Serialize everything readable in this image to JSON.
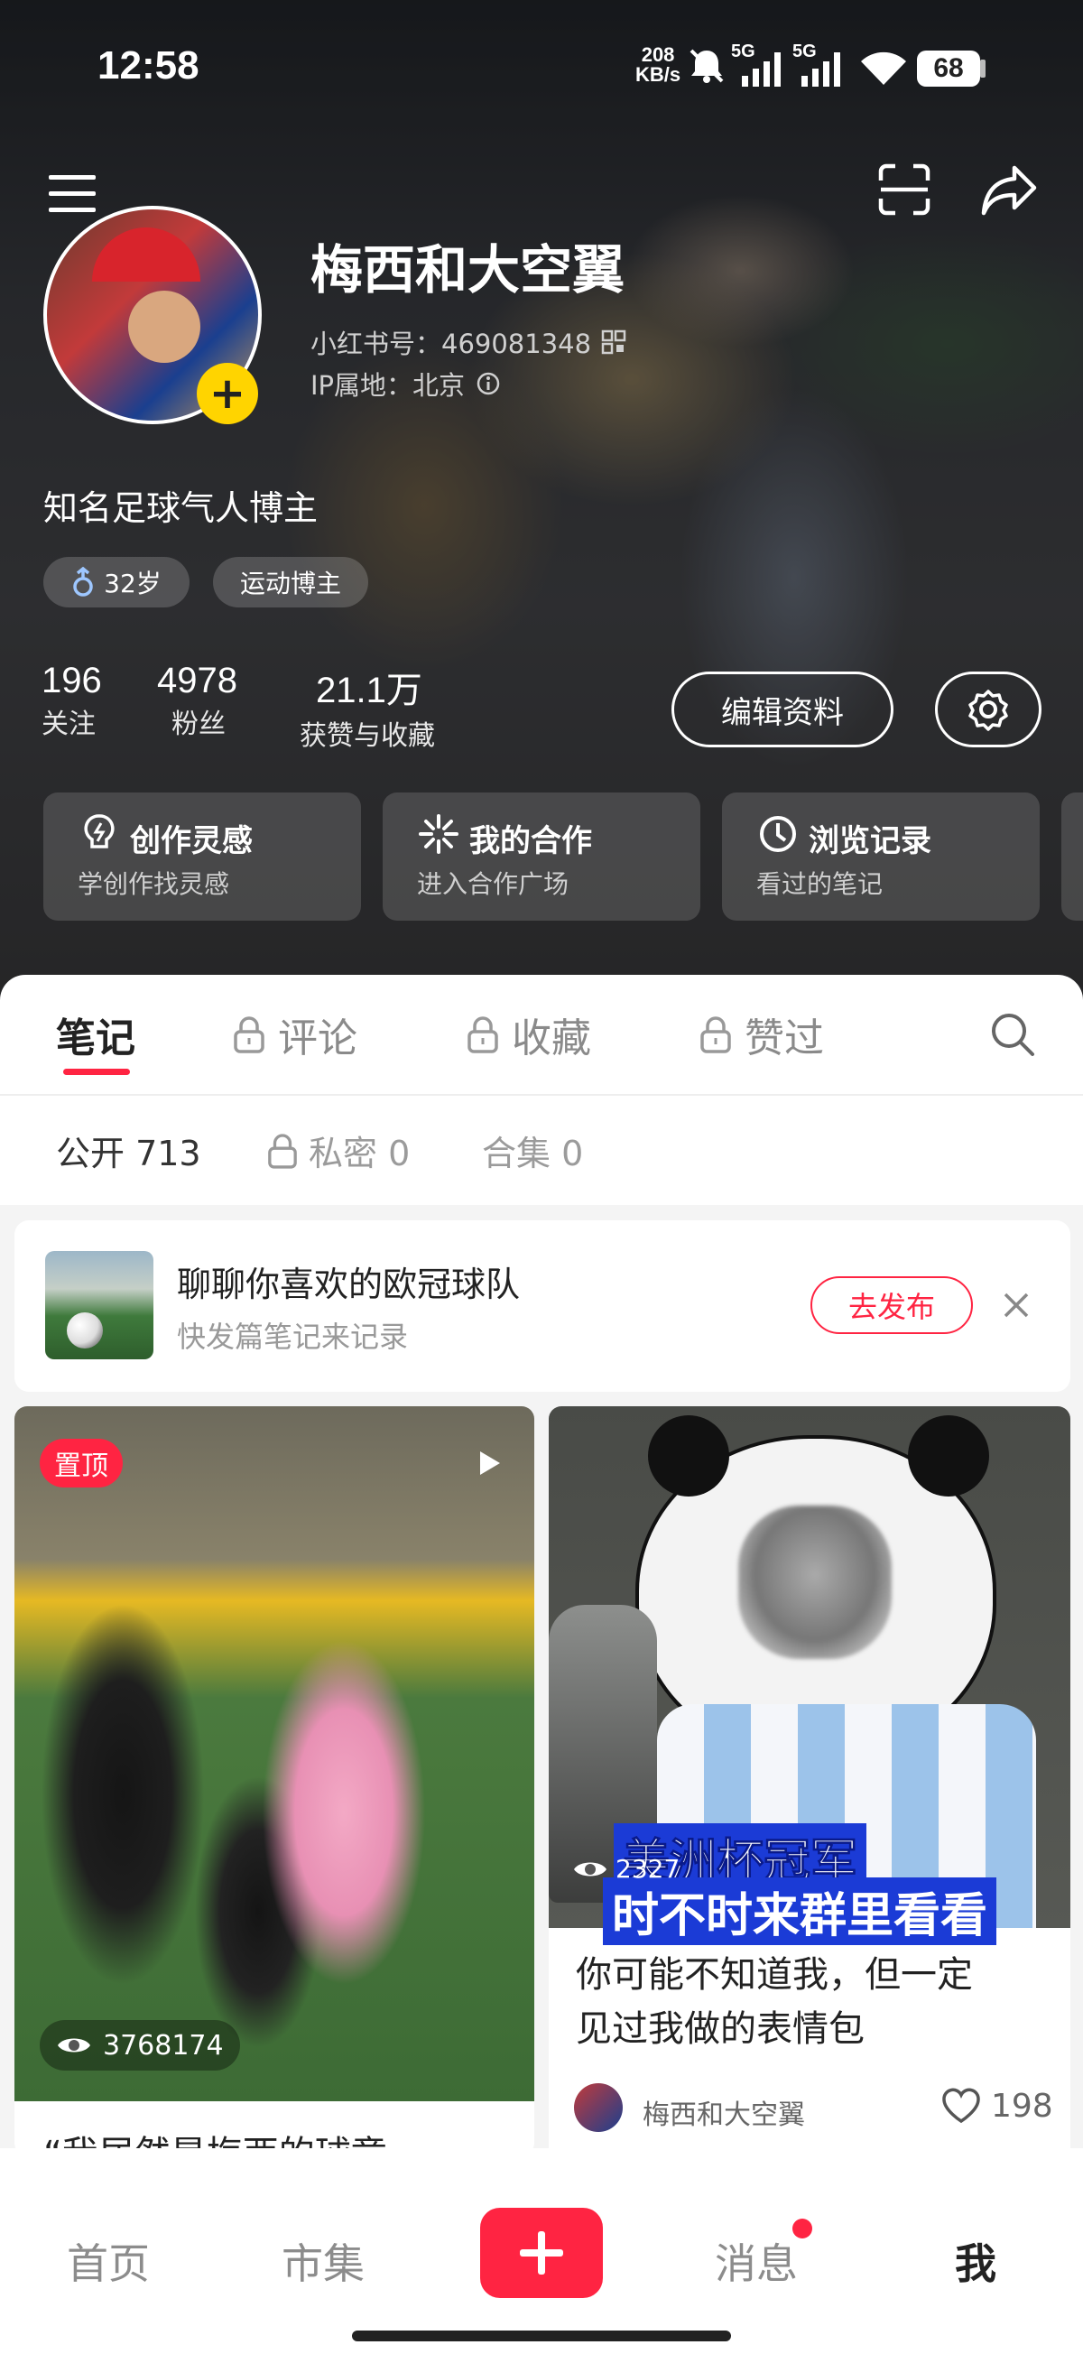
{
  "status_bar": {
    "time": "12:58",
    "net_speed_top": "208",
    "net_speed_bottom": "KB/s",
    "signal1": "5G",
    "signal2": "5G",
    "battery": "68"
  },
  "profile": {
    "name": "梅西和大空翼",
    "xhs_id": "小红书号：469081348",
    "ip": "IP属地：北京",
    "bio": "知名足球气人博主",
    "tags": [
      {
        "label": "32岁"
      },
      {
        "label": "运动博主"
      }
    ],
    "stats": [
      {
        "value": "196",
        "label": "关注"
      },
      {
        "value": "4978",
        "label": "粉丝"
      },
      {
        "value": "21.1万",
        "label": "获赞与收藏"
      }
    ],
    "edit_label": "编辑资料"
  },
  "cards": [
    {
      "title": "创作灵感",
      "subtitle": "学创作找灵感"
    },
    {
      "title": "我的合作",
      "subtitle": "进入合作广场"
    },
    {
      "title": "浏览记录",
      "subtitle": "看过的笔记"
    }
  ],
  "tabs": [
    {
      "label": "笔记"
    },
    {
      "label": "评论"
    },
    {
      "label": "收藏"
    },
    {
      "label": "赞过"
    }
  ],
  "subtabs": [
    {
      "label": "公开 713"
    },
    {
      "label": "私密 0"
    },
    {
      "label": "合集 0"
    }
  ],
  "prompt": {
    "title": "聊聊你喜欢的欧冠球队",
    "subtitle": "快发篇笔记来记录",
    "button": "去发布"
  },
  "posts": [
    {
      "badge": "置顶",
      "views": "3768174",
      "title": "“我居然是梅西的球童"
    },
    {
      "views": "2327",
      "caption_line1": "美洲杯冠军",
      "caption_line2": "时不时来群里看看",
      "title_line1": "你可能不知道我，但一定",
      "title_line2": "见过我做的表情包",
      "author": "梅西和大空翼",
      "likes": "198"
    }
  ],
  "bottom_nav": [
    {
      "label": "首页"
    },
    {
      "label": "市集"
    },
    {
      "label": "消息"
    },
    {
      "label": "我"
    }
  ],
  "colors": {
    "accent": "#ff2442",
    "tag_yellow": "#ffd400"
  }
}
